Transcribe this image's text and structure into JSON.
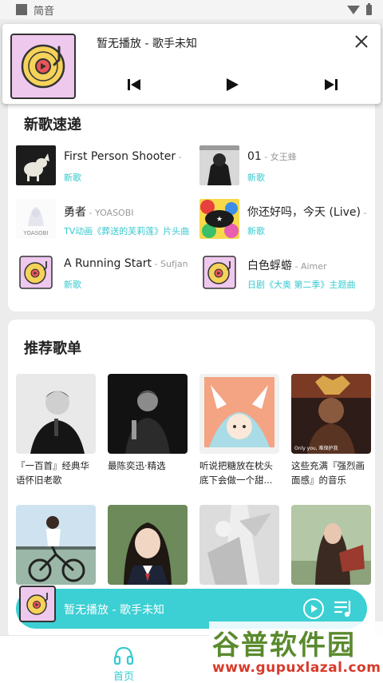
{
  "status_bar": {
    "app_name": "简音"
  },
  "notification": {
    "title": "暂无播放 - 歌手未知",
    "icons": [
      "music-disc-icon",
      "close-icon",
      "previous-icon",
      "play-icon",
      "next-icon"
    ]
  },
  "new_songs": {
    "title": "新歌速递",
    "items": [
      {
        "name": "First Person Shooter",
        "artist": " - ",
        "tag": "新歌"
      },
      {
        "name": "01",
        "artist": " - 女王蜂",
        "tag": "新歌"
      },
      {
        "name": "勇者",
        "artist": " - YOASOBI",
        "tag": "TV动画《葬送的芙莉莲》片头曲"
      },
      {
        "name": "你还好吗，今天 (Live)",
        "artist": " - ",
        "tag": "新歌"
      },
      {
        "name": "A Running Start",
        "artist": " - Sufjan",
        "tag": "新歌"
      },
      {
        "name": "白色蜉蝣",
        "artist": " - Aimer",
        "tag": "日剧《大奥 第二季》主题曲"
      }
    ],
    "cover_text": {
      "yoasobi": "YOASOBI"
    }
  },
  "playlists": {
    "title": "推荐歌单",
    "items": [
      {
        "title": "『一百首』经典华语怀旧老歌"
      },
      {
        "title": "最陈奕迅·精选"
      },
      {
        "title": "听说把糖放在枕头底下会做一个甜..."
      },
      {
        "title": "这些充满『强烈画面感』的音乐"
      },
      {
        "title": ""
      },
      {
        "title": ""
      },
      {
        "title": ""
      },
      {
        "title": ""
      }
    ],
    "overlay_text": {
      "p4": "Only you, 难保护我"
    }
  },
  "mini_player": {
    "title": "暂无播放 - 歌手未知"
  },
  "bottom_nav": {
    "home_label": "首页"
  },
  "watermark": {
    "main": "谷普软件园",
    "url": "www.gupuxlazal.com"
  },
  "colors": {
    "accent": "#38c9cf",
    "mini_player_bg": "#3ccfd3",
    "disc_bg": "#efc8ee",
    "disc_yellow": "#f5d25a",
    "disc_red": "#e8555a"
  }
}
